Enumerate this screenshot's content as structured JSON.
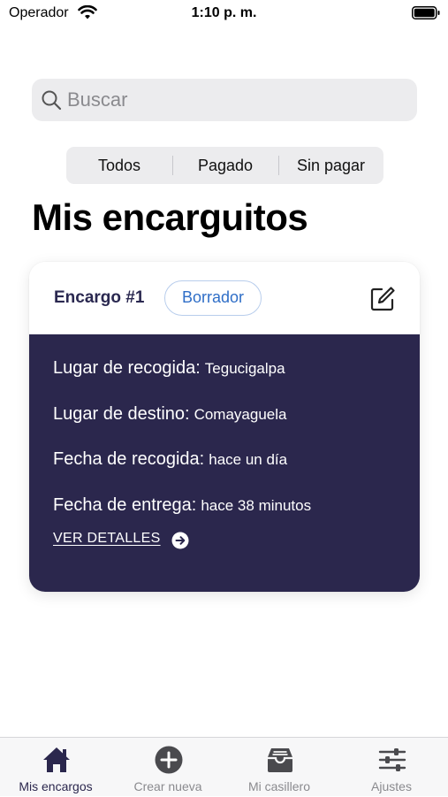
{
  "status_bar": {
    "carrier": "Operador",
    "time": "1:10 p. m."
  },
  "search": {
    "placeholder": "Buscar"
  },
  "filter_tabs": [
    {
      "label": "Todos"
    },
    {
      "label": "Pagado"
    },
    {
      "label": "Sin pagar"
    }
  ],
  "page_title": "Mis encarguitos",
  "orders": [
    {
      "title": "Encargo #1",
      "status": "Borrador",
      "pickup_place_label": "Lugar de recogida:",
      "pickup_place": "Tegucigalpa",
      "destination_label": "Lugar de destino:",
      "destination": "Comayaguela",
      "pickup_date_label": "Fecha de recogida:",
      "pickup_date": "hace un día",
      "delivery_date_label": "Fecha de entrega:",
      "delivery_date": "hace 38 minutos",
      "details_link": "VER DETALLES"
    }
  ],
  "tab_bar": [
    {
      "label": "Mis encargos",
      "icon": "home-icon",
      "active": true
    },
    {
      "label": "Crear nueva",
      "icon": "plus-circle-icon",
      "active": false
    },
    {
      "label": "Mi casillero",
      "icon": "inbox-tray-icon",
      "active": false
    },
    {
      "label": "Ajustes",
      "icon": "sliders-icon",
      "active": false
    }
  ],
  "colors": {
    "card_body": "#2b274d",
    "badge_text": "#2f6ec7",
    "tab_active": "#2b274d",
    "tab_inactive": "#8a8a8e"
  }
}
